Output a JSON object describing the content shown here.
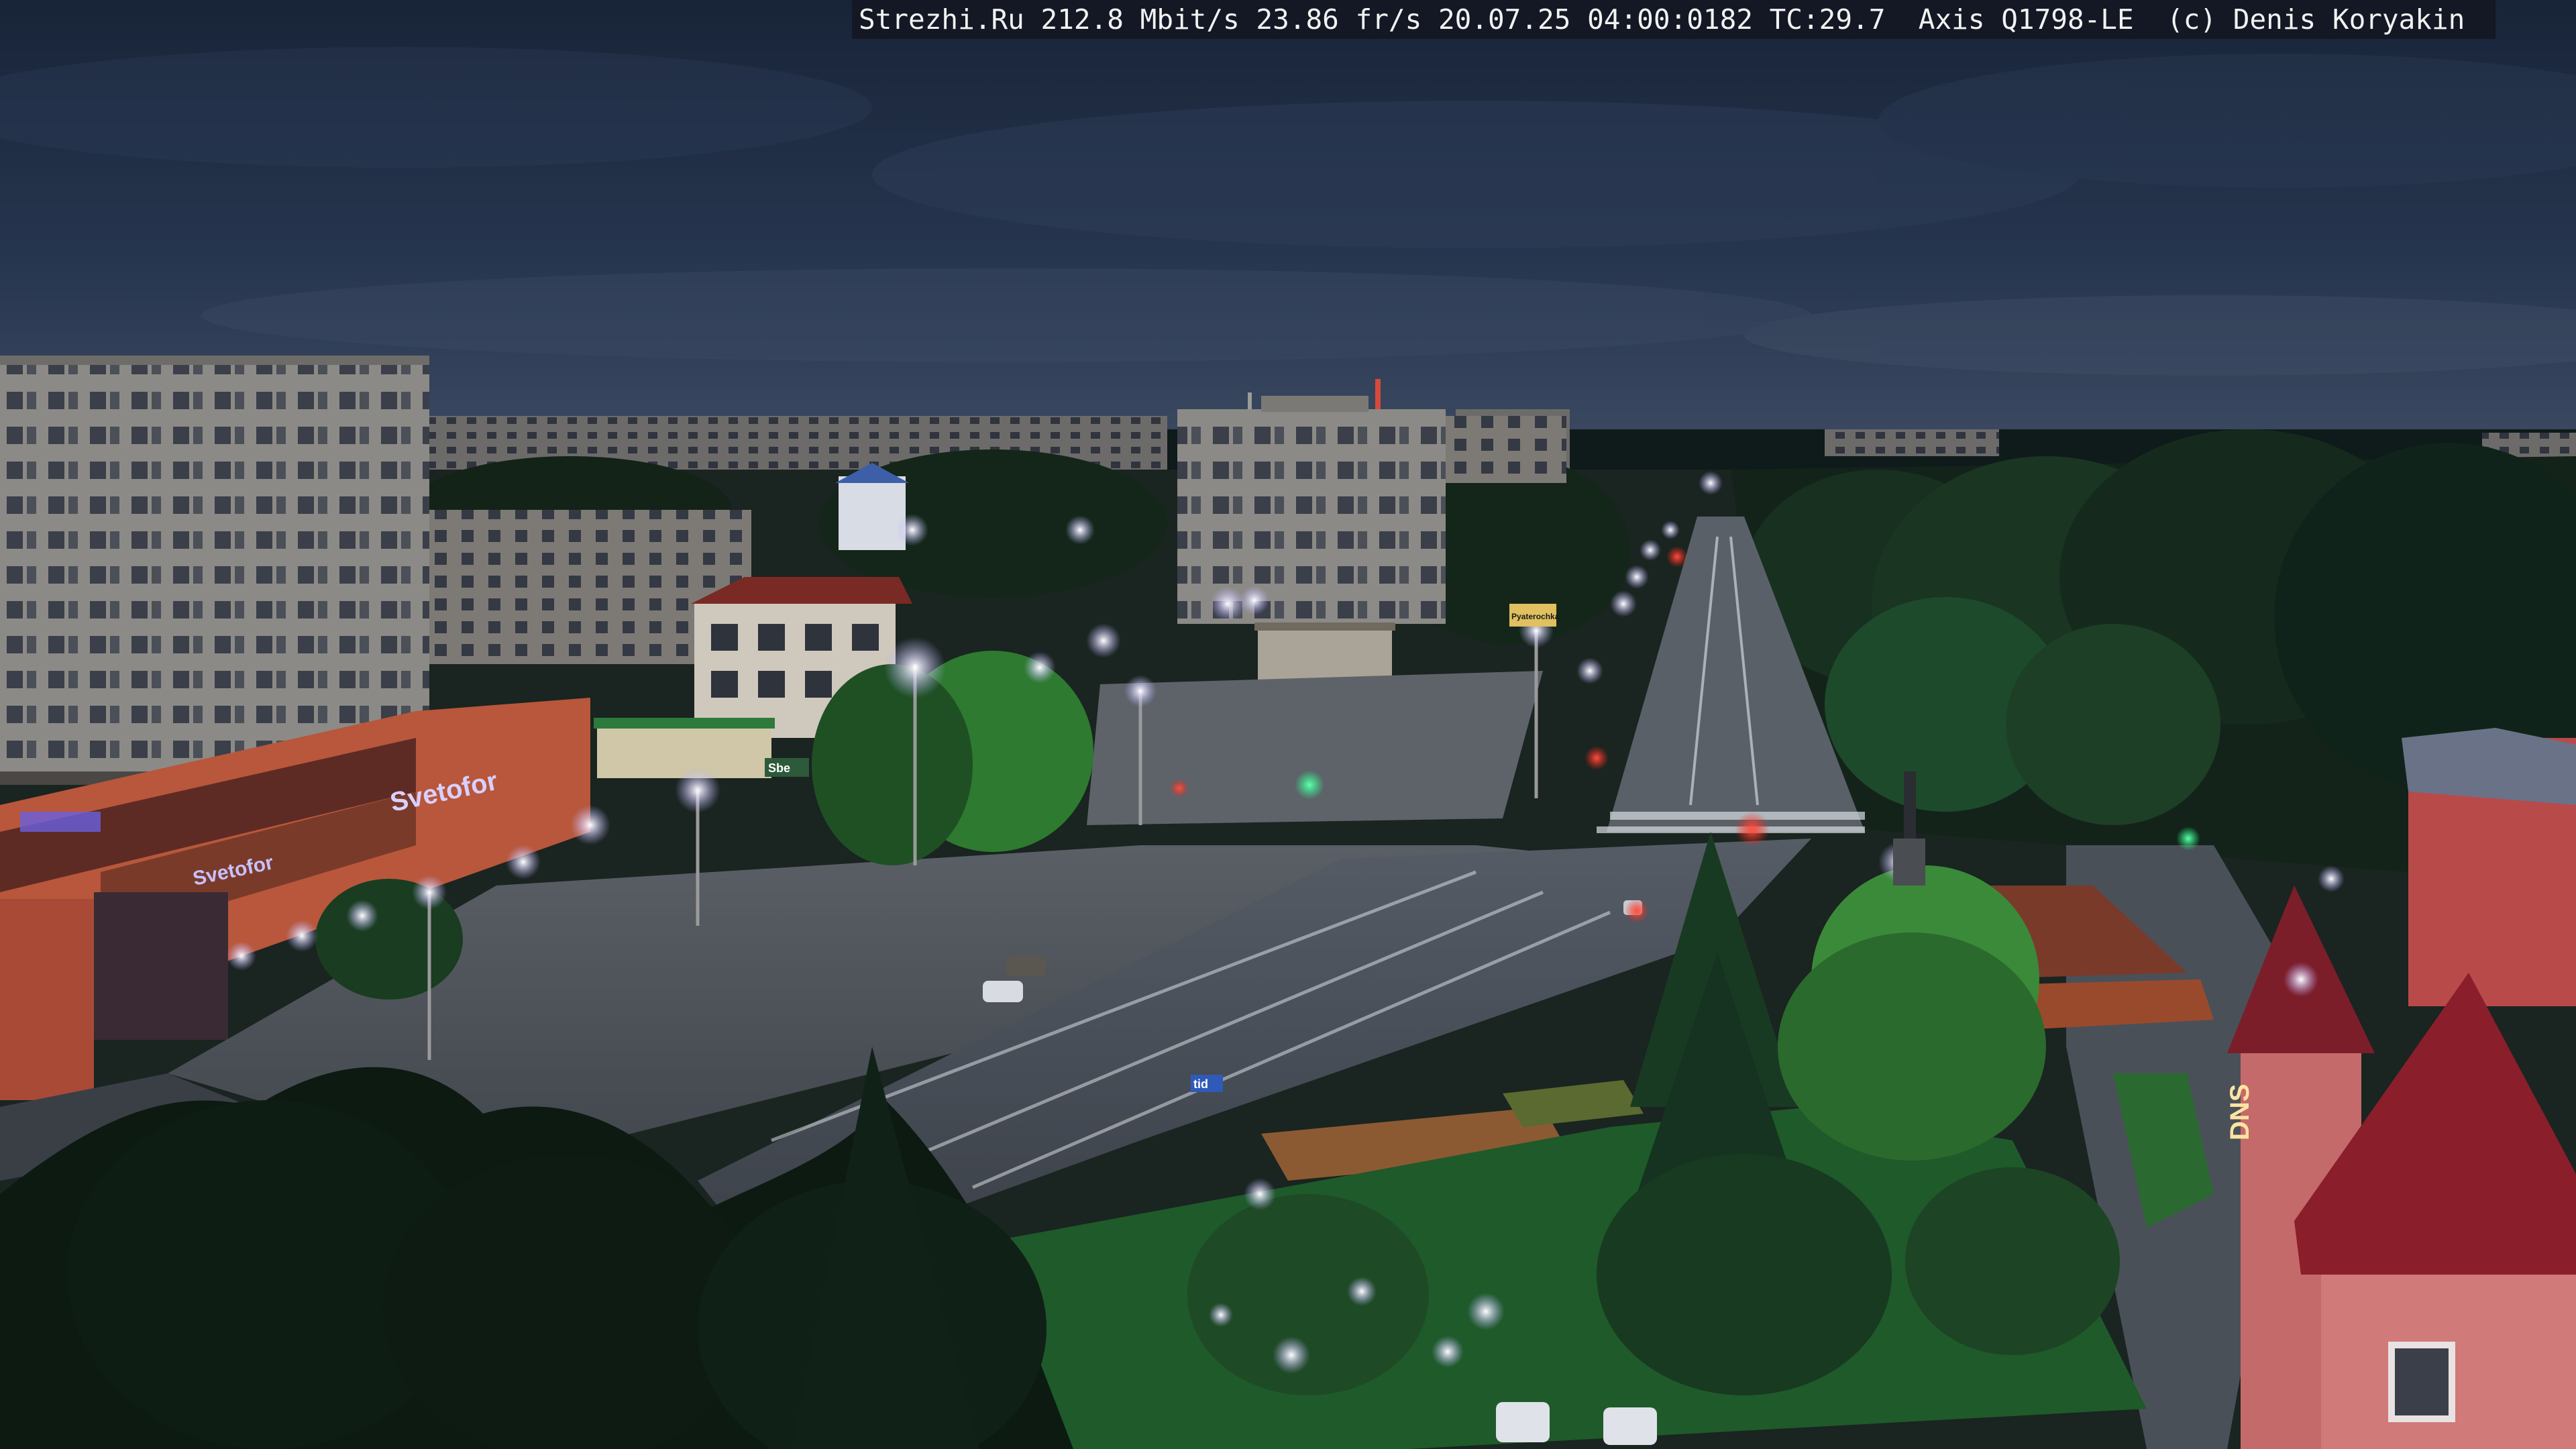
{
  "camera_overlay": {
    "text": "Strezhi.Ru 212.8 Mbit/s 23.86 fr/s 20.07.25 04:00:0182 TC:29.7  Axis Q1798-LE  (c) Denis Koryakin"
  },
  "signs": {
    "store": "Svetofor",
    "store_small": "Svetofor",
    "bus_sign": "Sbe",
    "lane_sign": "tid",
    "brand": "Pyaterochka",
    "corner_label": "DNS"
  },
  "colors": {
    "sky_top": "#1a2740",
    "sky_mid": "#2b3a55",
    "horizon": "#3a4860",
    "tree_dark": "#0f1f16",
    "grass": "#1f5a2a",
    "street_light": "#f4f0ff",
    "neon": "#7a6bff",
    "signal_red": "#ff3030",
    "signal_green": "#30ff90"
  }
}
